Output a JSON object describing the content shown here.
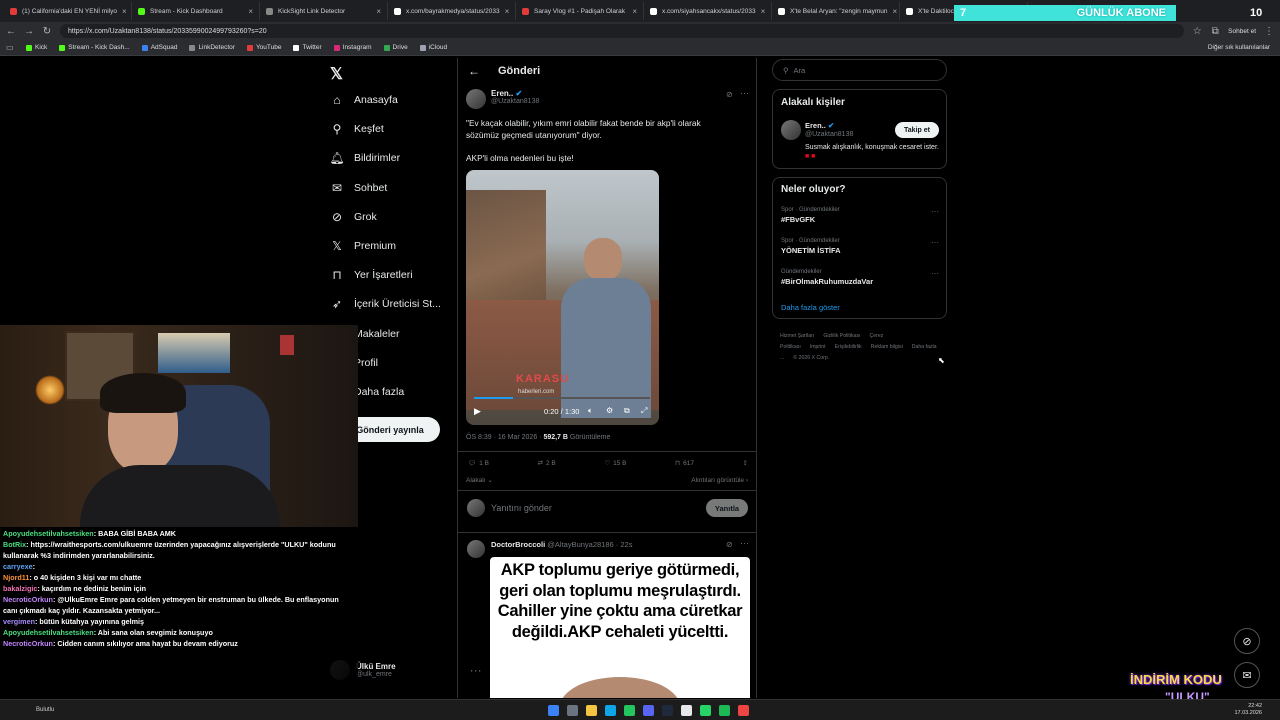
{
  "browser": {
    "tabs": [
      {
        "title": "(1) California'daki EN YENİ milyo",
        "color": "#e23b3b"
      },
      {
        "title": "Stream - Kick Dashboard",
        "color": "#53fc18"
      },
      {
        "title": "KickSight Link Detector",
        "color": "#888888"
      },
      {
        "title": "x.com/bayrakmedya/status/2033",
        "color": "#ffffff"
      },
      {
        "title": "Saray Vlog #1 - Padişah Olarak",
        "color": "#e23b3b"
      },
      {
        "title": "x.com/siyahsancakx/status/2033",
        "color": "#ffffff"
      },
      {
        "title": "X'te Belal Aryan: \"zengin maymun",
        "color": "#ffffff"
      },
      {
        "title": "X'te Daktilocki: \"Otonom sürüş",
        "color": "#ffffff"
      }
    ],
    "url": "https://x.com/Uzaktan8138/status/2033599002499793260?s=20",
    "profile_label": "Sohbet et",
    "bookmarks": [
      {
        "label": "Kick",
        "color": "#53fc18"
      },
      {
        "label": "Stream - Kick Dash...",
        "color": "#53fc18"
      },
      {
        "label": "AdSquad",
        "color": "#3b82f6"
      },
      {
        "label": "LinkDetector",
        "color": "#888888"
      },
      {
        "label": "YouTube",
        "color": "#e23b3b"
      },
      {
        "label": "Twitter",
        "color": "#ffffff"
      },
      {
        "label": "Instagram",
        "color": "#d62976"
      },
      {
        "label": "Drive",
        "color": "#34a853"
      },
      {
        "label": "iCloud",
        "color": "#9ca3af"
      }
    ],
    "other_bookmarks": "Diğer sık kullanılanlar"
  },
  "overlay": {
    "sub_goal_current": "7",
    "sub_goal_label": "GÜNLÜK ABONE",
    "sub_goal_target": "10",
    "discount_line1": "İNDİRİM KODU",
    "discount_line2": "\"ULKU\""
  },
  "nav": {
    "items": [
      {
        "label": "Anasayfa",
        "icon": "home-icon"
      },
      {
        "label": "Keşfet",
        "icon": "search-icon"
      },
      {
        "label": "Bildirimler",
        "icon": "bell-icon"
      },
      {
        "label": "Sohbet",
        "icon": "mail-icon"
      },
      {
        "label": "Grok",
        "icon": "grok-icon"
      },
      {
        "label": "Premium",
        "icon": "x-logo-icon"
      },
      {
        "label": "Yer İşaretleri",
        "icon": "bookmark-icon"
      },
      {
        "label": "İçerik Üreticisi St...",
        "icon": "rocket-icon"
      },
      {
        "label": "Makaleler",
        "icon": "article-icon"
      },
      {
        "label": "Profil",
        "icon": "user-icon"
      },
      {
        "label": "Daha fazla",
        "icon": "more-icon"
      }
    ],
    "post_button": "Gönderi yayınla",
    "account_name": "Ülkü Emre",
    "account_handle": "@ulk_emre"
  },
  "main": {
    "header": "Gönderi",
    "tweet": {
      "author": "Eren..",
      "handle": "@Uzaktan8138",
      "text1": "\"Ev kaçak olabilir, yıkım emri olabilir fakat bende bir akp'li olarak sözümüz geçmedi utanıyorum\" diyor.",
      "text2": "AKP'li olma nedenleri bu işte!",
      "video_time": "0:20 / 1:30",
      "watermark": "KARASU",
      "watermark_sub": "haberleri.com",
      "timestamp": "ÖS 8:39 · 16 Mar 2026 ·",
      "views": "592,7 B",
      "views_label": "Görüntüleme",
      "replies": "1 B",
      "retweets": "2 B",
      "likes": "15 B",
      "bookmarks": "617",
      "related": "Alakalı",
      "quotes": "Alıntıları görüntüle"
    },
    "reply_placeholder": "Yanıtını gönder",
    "reply_button": "Yanıtla",
    "reply": {
      "author": "DoctorBroccoli",
      "handle": "@AltayBunya28186 · 22s",
      "image_text": "AKP toplumu geriye götürmedi, geri olan toplumu meşrulaştırdı. Cahiller yine çoktu ama cüretkar değildi.AKP cehaleti yüceltti."
    }
  },
  "right": {
    "search_placeholder": "Ara",
    "relevant_title": "Alakalı kişiler",
    "person_name": "Eren..",
    "person_handle": "@Uzaktan8138",
    "follow_label": "Takip et",
    "person_bio": "Susmak alışkanlık, konuşmak cesaret ister.",
    "whats_happening": "Neler oluyor?",
    "trends": [
      {
        "category": "Spor · Gündemdekiler",
        "name": "#FBvGFK"
      },
      {
        "category": "Spor · Gündemdekiler",
        "name": "YÖNETİM İSTİFA"
      },
      {
        "category": "Gündemdekiler",
        "name": "#BirOlmakRuhumuzdaVar"
      }
    ],
    "show_more": "Daha fazla göster",
    "footer": [
      "Hizmet Şartları",
      "Gizlilik Politikası",
      "Çerez Politikası",
      "Imprint",
      "Erişilebilirlik",
      "Reklam bilgisi",
      "Daha fazla ...",
      "© 2026 X Corp."
    ]
  },
  "chat": {
    "messages": [
      {
        "user": "Apoyudehsetilvahsetsiken",
        "color": "#4ade80",
        "text": ": BABA GİBİ BABA AMK"
      },
      {
        "user": "BotRix",
        "color": "#4ade80",
        "text": ": https://wraithesports.com/ulkuemre üzerinden yapacağınız alışverişlerde \"ULKU\" kodunu kullanarak %3 indirimden yararlanabilirsiniz."
      },
      {
        "user": "carryexe",
        "color": "#60a5fa",
        "text": ": "
      },
      {
        "user": "Njord11",
        "color": "#fb923c",
        "text": ": o 40 kişiden 3 kişi var mı chatte"
      },
      {
        "user": "bakalzigic",
        "color": "#f472b6",
        "text": ": kaçırdım ne dediniz benim için"
      },
      {
        "user": "NecroticOrkun",
        "color": "#c084fc",
        "text": ": @UlkuEmre Emre para colden yetmeyen bir enstruman bu ülkede. Bu enflasyonun canı çıkmadı kaç yıldır. Kazansakta yetmiyor..."
      },
      {
        "user": "vergimen",
        "color": "#a78bfa",
        "text": ": bütün kütahya yayınına gelmiş"
      },
      {
        "user": "Apoyudehsetilvahsetsiken",
        "color": "#4ade80",
        "text": ": Abi sana olan sevgimiz konuşuyo"
      },
      {
        "user": "NecroticOrkun",
        "color": "#c084fc",
        "text": ": Cidden canım sıkılıyor ama hayat bu devam ediyoruz"
      }
    ]
  },
  "taskbar": {
    "weather": "Bulutlu",
    "time": "22:42",
    "date": "17.03.2026"
  }
}
